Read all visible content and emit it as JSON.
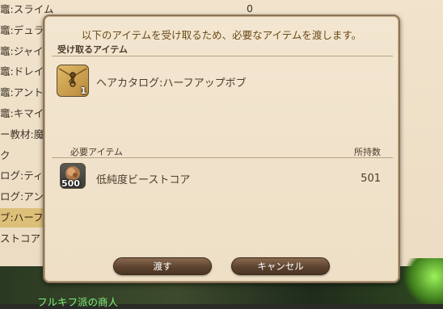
{
  "background": {
    "rows": [
      {
        "text": "竈:スライム",
        "highlight": false
      },
      {
        "text": "竈:デュラハ",
        "highlight": false
      },
      {
        "text": "竈:ジャイア",
        "highlight": false
      },
      {
        "text": "竈:ドレイク",
        "highlight": false
      },
      {
        "text": "竈:アントリ",
        "highlight": false
      },
      {
        "text": "竈:キマイラ",
        "highlight": false
      },
      {
        "text": "ー教材:魔器",
        "highlight": false
      },
      {
        "text": "ク",
        "highlight": false
      },
      {
        "text": "ログ:ティ",
        "highlight": false
      },
      {
        "text": "ログ:アン",
        "highlight": false
      },
      {
        "text": "ブ:ハーフア",
        "highlight": true
      },
      {
        "text": "ストコア",
        "highlight": false
      }
    ],
    "top_count": "0",
    "npc_name": "フルキフ派の商人"
  },
  "dialog": {
    "message": "以下のアイテムを受け取るため、必要なアイテムを渡します。",
    "receive_label": "受け取るアイテム",
    "receive_item": {
      "name": "ヘアカタログ:ハーフアップボブ",
      "quantity": "1",
      "icon": "envelope-catalog-icon"
    },
    "required_label": "必要アイテム",
    "owned_label": "所持数",
    "required_item": {
      "name": "低純度ビーストコア",
      "quantity": "500",
      "owned": "501",
      "icon": "beast-core-icon"
    },
    "buttons": {
      "give": "渡す",
      "cancel": "キャンセル"
    }
  }
}
